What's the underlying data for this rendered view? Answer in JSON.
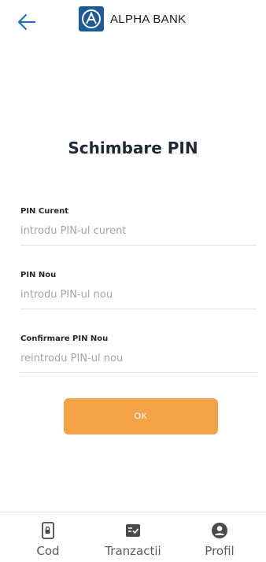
{
  "header": {
    "back_icon": "arrow-left-icon",
    "brand": {
      "name": "ALPHA BANK",
      "logo_icon": "alpha-bank-logo"
    }
  },
  "title": "Schimbare PIN",
  "form": {
    "fields": [
      {
        "label": "PIN Curent",
        "placeholder": "introdu PIN-ul curent",
        "value": ""
      },
      {
        "label": "PIN Nou",
        "placeholder": "introdu PIN-ul nou",
        "value": ""
      },
      {
        "label": "Confirmare PIN Nou",
        "placeholder": "reintrodu PIN-ul nou",
        "value": ""
      }
    ],
    "submit_label": "OK"
  },
  "tabbar": {
    "items": [
      {
        "label": "Cod",
        "icon": "phone-lock-icon"
      },
      {
        "label": "Tranzactii",
        "icon": "list-check-icon"
      },
      {
        "label": "Profil",
        "icon": "user-circle-icon"
      }
    ]
  },
  "colors": {
    "accent": "#f4a246",
    "brand_blue": "#1c5b97",
    "back_arrow": "#2170c2",
    "icon_gray": "#4a4a4a"
  }
}
